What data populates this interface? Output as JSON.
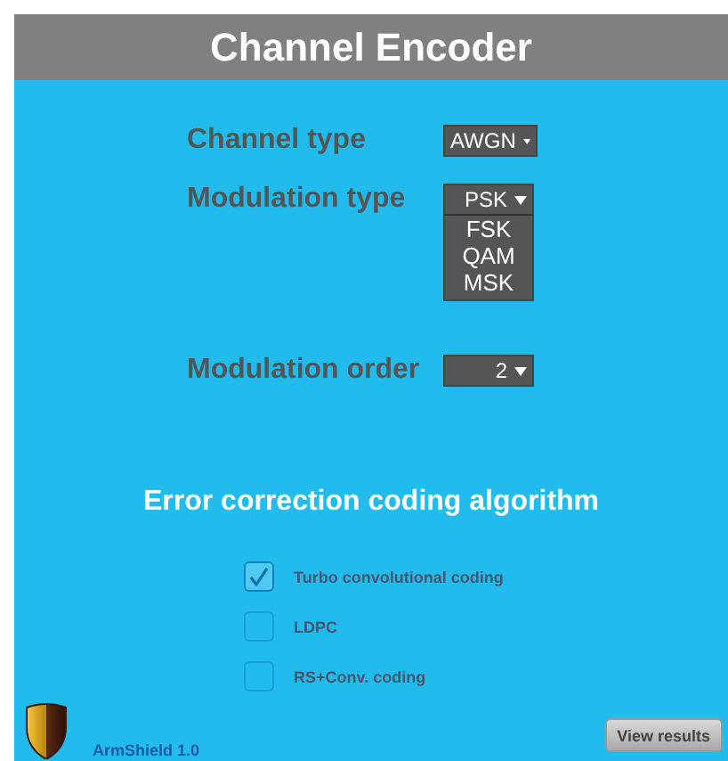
{
  "window": {
    "title": "Channel Encoder"
  },
  "fields": [
    {
      "label": "Channel type",
      "value": "AWGN",
      "expanded": false
    },
    {
      "label": "Modulation type",
      "value": "PSK",
      "expanded": true,
      "options": [
        "FSK",
        "QAM",
        "MSK"
      ]
    },
    {
      "label": "Modulation order",
      "value": "2",
      "expanded": false
    }
  ],
  "coding": {
    "heading": "Error correction coding algorithm",
    "options": [
      {
        "label": "Turbo convolutional coding",
        "checked": true
      },
      {
        "label": "LDPC",
        "checked": false
      },
      {
        "label": "RS+Conv. coding",
        "checked": false
      }
    ]
  },
  "footer": {
    "app_name": "ArmShield 1.0",
    "button": "View results"
  }
}
